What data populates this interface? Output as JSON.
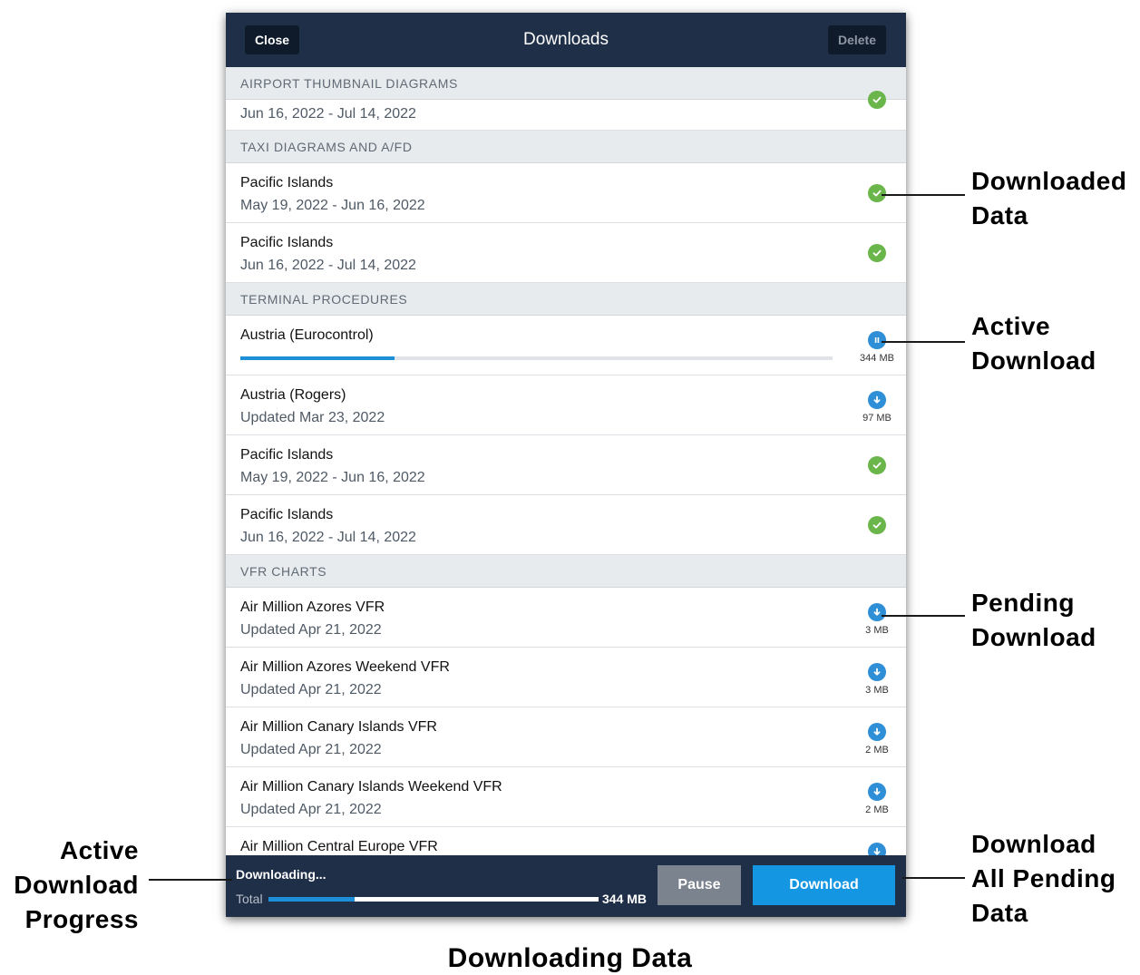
{
  "header": {
    "close_label": "Close",
    "title": "Downloads",
    "delete_label": "Delete"
  },
  "sections": [
    {
      "name": "AIRPORT THUMBNAIL DIAGRAMS",
      "items": [
        {
          "subtitle": "Jun 16, 2022 - Jul 14, 2022",
          "status": "downloaded"
        }
      ]
    },
    {
      "name": "TAXI DIAGRAMS AND A/FD",
      "items": [
        {
          "title": "Pacific Islands",
          "subtitle": "May 19, 2022 - Jun 16, 2022",
          "status": "downloaded"
        },
        {
          "title": "Pacific Islands",
          "subtitle": "Jun 16, 2022 - Jul 14, 2022",
          "status": "downloaded"
        }
      ]
    },
    {
      "name": "TERMINAL PROCEDURES",
      "items": [
        {
          "title": "Austria (Eurocontrol)",
          "status": "active",
          "size": "344 MB",
          "progress": 0.26
        },
        {
          "title": "Austria (Rogers)",
          "subtitle": "Updated Mar 23, 2022",
          "status": "pending",
          "size": "97 MB"
        },
        {
          "title": "Pacific Islands",
          "subtitle": "May 19, 2022 - Jun 16, 2022",
          "status": "downloaded"
        },
        {
          "title": "Pacific Islands",
          "subtitle": "Jun 16, 2022 - Jul 14, 2022",
          "status": "downloaded"
        }
      ]
    },
    {
      "name": "VFR CHARTS",
      "items": [
        {
          "title": "Air Million Azores VFR",
          "subtitle": "Updated Apr 21, 2022",
          "status": "pending",
          "size": "3 MB"
        },
        {
          "title": "Air Million Azores Weekend VFR",
          "subtitle": "Updated Apr 21, 2022",
          "status": "pending",
          "size": "3 MB"
        },
        {
          "title": "Air Million Canary Islands VFR",
          "subtitle": "Updated Apr 21, 2022",
          "status": "pending",
          "size": "2 MB"
        },
        {
          "title": "Air Million Canary Islands Weekend VFR",
          "subtitle": "Updated Apr 21, 2022",
          "status": "pending",
          "size": "2 MB"
        },
        {
          "title": "Air Million Central Europe VFR",
          "status": "pending"
        }
      ]
    }
  ],
  "footer": {
    "status_label": "Downloading...",
    "total_label": "Total",
    "total_size": "344 MB",
    "total_progress": 0.26,
    "pause_label": "Pause",
    "download_label": "Download"
  },
  "callouts": {
    "downloaded": "Downloaded\nData",
    "active": "Active\nDownload",
    "pending": "Pending\nDownload",
    "download_all": "Download\nAll Pending\nData",
    "progress": "Active\nDownload\nProgress"
  },
  "caption": "Downloading Data",
  "colors": {
    "header_bg": "#1f2f48",
    "downloaded": "#6ab64b",
    "pending": "#2e8fd6",
    "accent": "#1496e3",
    "pause_button": "#7b838f"
  }
}
